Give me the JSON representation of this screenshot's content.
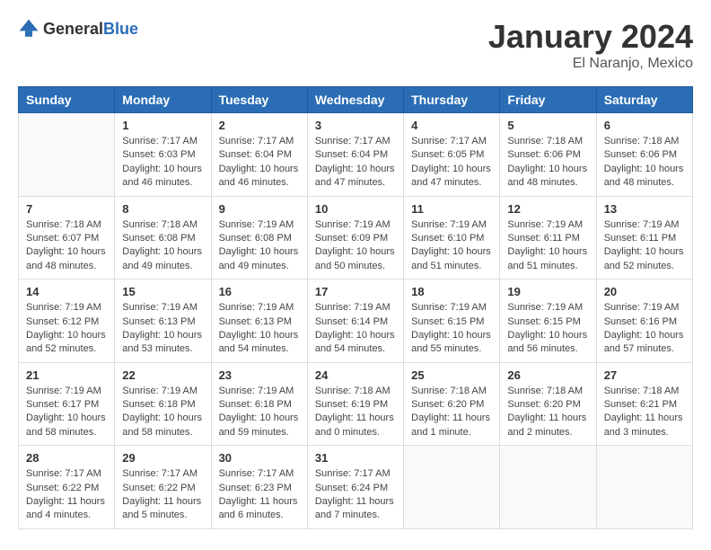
{
  "header": {
    "logo": {
      "text_general": "General",
      "text_blue": "Blue"
    },
    "title": "January 2024",
    "subtitle": "El Naranjo, Mexico"
  },
  "calendar": {
    "headers": [
      "Sunday",
      "Monday",
      "Tuesday",
      "Wednesday",
      "Thursday",
      "Friday",
      "Saturday"
    ],
    "weeks": [
      [
        {
          "day": "",
          "info": ""
        },
        {
          "day": "1",
          "info": "Sunrise: 7:17 AM\nSunset: 6:03 PM\nDaylight: 10 hours\nand 46 minutes."
        },
        {
          "day": "2",
          "info": "Sunrise: 7:17 AM\nSunset: 6:04 PM\nDaylight: 10 hours\nand 46 minutes."
        },
        {
          "day": "3",
          "info": "Sunrise: 7:17 AM\nSunset: 6:04 PM\nDaylight: 10 hours\nand 47 minutes."
        },
        {
          "day": "4",
          "info": "Sunrise: 7:17 AM\nSunset: 6:05 PM\nDaylight: 10 hours\nand 47 minutes."
        },
        {
          "day": "5",
          "info": "Sunrise: 7:18 AM\nSunset: 6:06 PM\nDaylight: 10 hours\nand 48 minutes."
        },
        {
          "day": "6",
          "info": "Sunrise: 7:18 AM\nSunset: 6:06 PM\nDaylight: 10 hours\nand 48 minutes."
        }
      ],
      [
        {
          "day": "7",
          "info": "Sunrise: 7:18 AM\nSunset: 6:07 PM\nDaylight: 10 hours\nand 48 minutes."
        },
        {
          "day": "8",
          "info": "Sunrise: 7:18 AM\nSunset: 6:08 PM\nDaylight: 10 hours\nand 49 minutes."
        },
        {
          "day": "9",
          "info": "Sunrise: 7:19 AM\nSunset: 6:08 PM\nDaylight: 10 hours\nand 49 minutes."
        },
        {
          "day": "10",
          "info": "Sunrise: 7:19 AM\nSunset: 6:09 PM\nDaylight: 10 hours\nand 50 minutes."
        },
        {
          "day": "11",
          "info": "Sunrise: 7:19 AM\nSunset: 6:10 PM\nDaylight: 10 hours\nand 51 minutes."
        },
        {
          "day": "12",
          "info": "Sunrise: 7:19 AM\nSunset: 6:11 PM\nDaylight: 10 hours\nand 51 minutes."
        },
        {
          "day": "13",
          "info": "Sunrise: 7:19 AM\nSunset: 6:11 PM\nDaylight: 10 hours\nand 52 minutes."
        }
      ],
      [
        {
          "day": "14",
          "info": "Sunrise: 7:19 AM\nSunset: 6:12 PM\nDaylight: 10 hours\nand 52 minutes."
        },
        {
          "day": "15",
          "info": "Sunrise: 7:19 AM\nSunset: 6:13 PM\nDaylight: 10 hours\nand 53 minutes."
        },
        {
          "day": "16",
          "info": "Sunrise: 7:19 AM\nSunset: 6:13 PM\nDaylight: 10 hours\nand 54 minutes."
        },
        {
          "day": "17",
          "info": "Sunrise: 7:19 AM\nSunset: 6:14 PM\nDaylight: 10 hours\nand 54 minutes."
        },
        {
          "day": "18",
          "info": "Sunrise: 7:19 AM\nSunset: 6:15 PM\nDaylight: 10 hours\nand 55 minutes."
        },
        {
          "day": "19",
          "info": "Sunrise: 7:19 AM\nSunset: 6:15 PM\nDaylight: 10 hours\nand 56 minutes."
        },
        {
          "day": "20",
          "info": "Sunrise: 7:19 AM\nSunset: 6:16 PM\nDaylight: 10 hours\nand 57 minutes."
        }
      ],
      [
        {
          "day": "21",
          "info": "Sunrise: 7:19 AM\nSunset: 6:17 PM\nDaylight: 10 hours\nand 58 minutes."
        },
        {
          "day": "22",
          "info": "Sunrise: 7:19 AM\nSunset: 6:18 PM\nDaylight: 10 hours\nand 58 minutes."
        },
        {
          "day": "23",
          "info": "Sunrise: 7:19 AM\nSunset: 6:18 PM\nDaylight: 10 hours\nand 59 minutes."
        },
        {
          "day": "24",
          "info": "Sunrise: 7:18 AM\nSunset: 6:19 PM\nDaylight: 11 hours\nand 0 minutes."
        },
        {
          "day": "25",
          "info": "Sunrise: 7:18 AM\nSunset: 6:20 PM\nDaylight: 11 hours\nand 1 minute."
        },
        {
          "day": "26",
          "info": "Sunrise: 7:18 AM\nSunset: 6:20 PM\nDaylight: 11 hours\nand 2 minutes."
        },
        {
          "day": "27",
          "info": "Sunrise: 7:18 AM\nSunset: 6:21 PM\nDaylight: 11 hours\nand 3 minutes."
        }
      ],
      [
        {
          "day": "28",
          "info": "Sunrise: 7:17 AM\nSunset: 6:22 PM\nDaylight: 11 hours\nand 4 minutes."
        },
        {
          "day": "29",
          "info": "Sunrise: 7:17 AM\nSunset: 6:22 PM\nDaylight: 11 hours\nand 5 minutes."
        },
        {
          "day": "30",
          "info": "Sunrise: 7:17 AM\nSunset: 6:23 PM\nDaylight: 11 hours\nand 6 minutes."
        },
        {
          "day": "31",
          "info": "Sunrise: 7:17 AM\nSunset: 6:24 PM\nDaylight: 11 hours\nand 7 minutes."
        },
        {
          "day": "",
          "info": ""
        },
        {
          "day": "",
          "info": ""
        },
        {
          "day": "",
          "info": ""
        }
      ]
    ]
  }
}
